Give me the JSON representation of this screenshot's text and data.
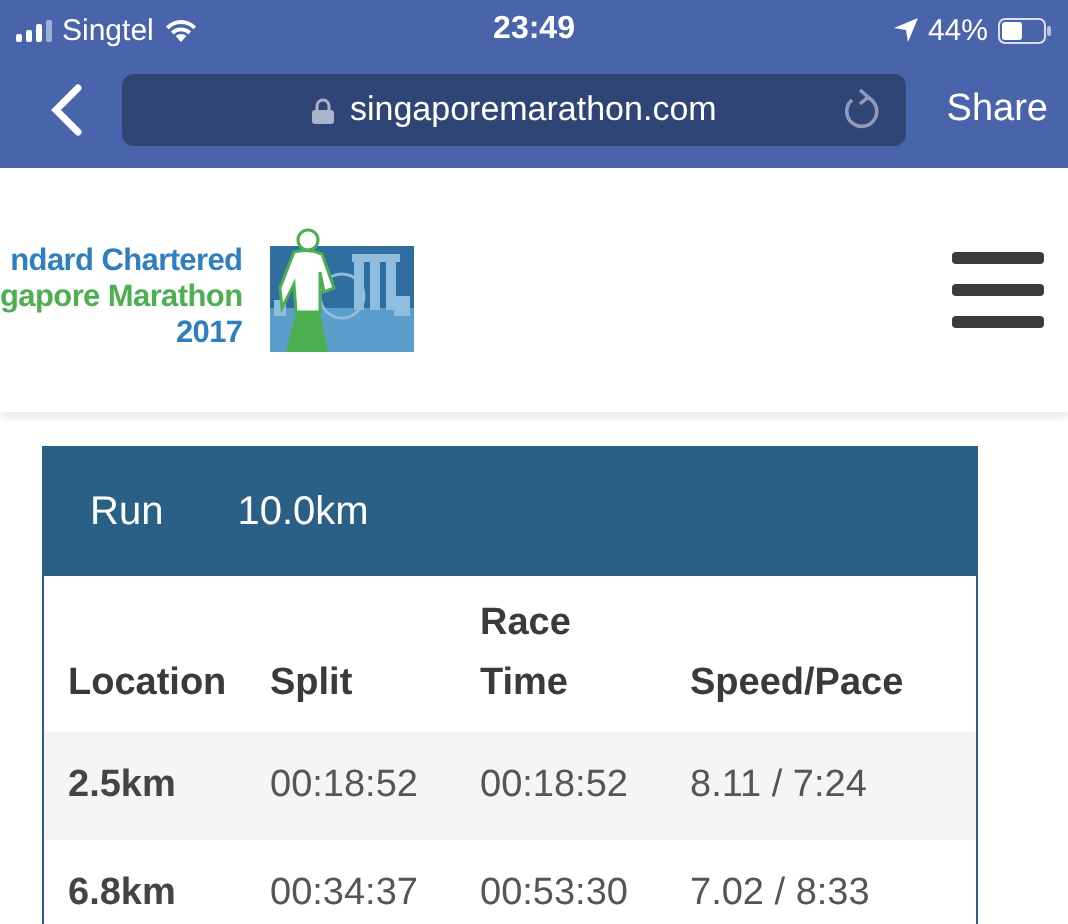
{
  "status_bar": {
    "carrier": "Singtel",
    "time": "23:49",
    "battery": "44%"
  },
  "browser": {
    "url": "singaporemarathon.com",
    "share": "Share"
  },
  "header": {
    "logo_lines": [
      "ndard Chartered",
      "gapore Marathon",
      "2017"
    ]
  },
  "results": {
    "event": "Run",
    "distance": "10.0km",
    "columns": [
      "Location",
      "Split",
      "Race\nTime",
      "Speed/Pace"
    ],
    "rows": [
      {
        "cells": [
          "2.5km",
          "00:18:52",
          "00:18:52",
          "8.11 / 7:24"
        ]
      },
      {
        "cells": [
          "6.8km",
          "00:34:37",
          "00:53:30",
          "7.02 / 8:33"
        ]
      }
    ]
  }
}
